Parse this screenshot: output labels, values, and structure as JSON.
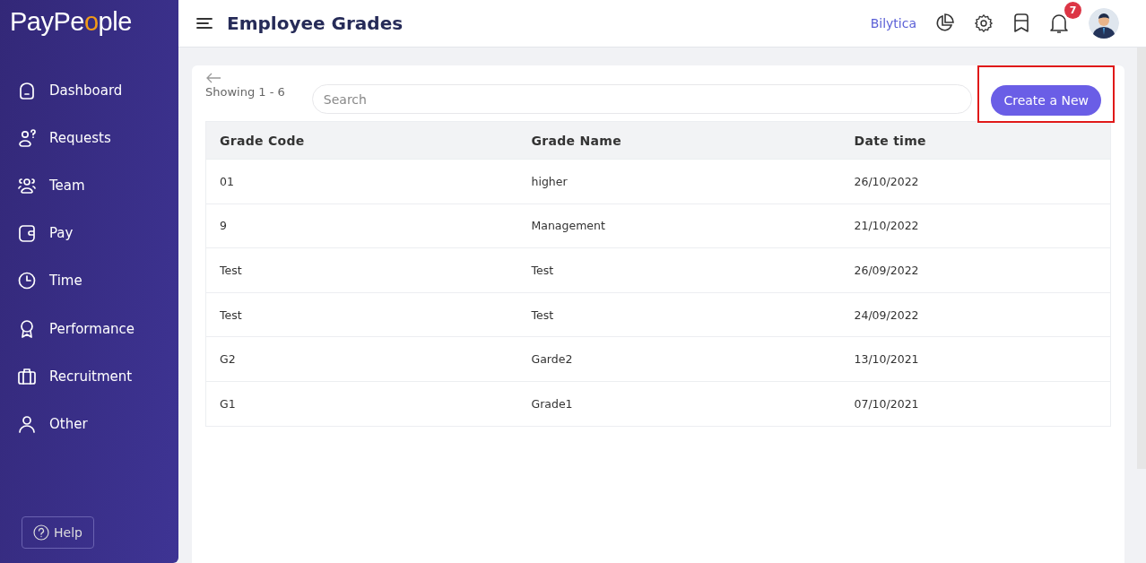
{
  "sidebar": {
    "logo": {
      "before": "PayPe",
      "accent": "o",
      "after": "ple"
    },
    "items": [
      {
        "label": "Dashboard",
        "selected": false
      },
      {
        "label": "Requests",
        "selected": false
      },
      {
        "label": "Team",
        "selected": false
      },
      {
        "label": "Pay",
        "selected": false
      },
      {
        "label": "Time",
        "selected": false
      },
      {
        "label": "Performance",
        "selected": false
      },
      {
        "label": "Recruitment",
        "selected": false
      },
      {
        "label": "Other",
        "selected": false
      }
    ],
    "help": {
      "label": "Help"
    }
  },
  "header": {
    "title": "Employee Grades",
    "link": "Bilytica",
    "notification_count": "7"
  },
  "content": {
    "showing": "Showing 1 - 6",
    "search": {
      "placeholder": "Search"
    },
    "create_button": {
      "label": "Create a New",
      "highlighted": true
    },
    "table": {
      "columns": [
        "Grade Code",
        "Grade Name",
        "Date time"
      ],
      "rows": [
        [
          "01",
          "higher",
          "26/10/2022"
        ],
        [
          "9",
          "Management",
          "21/10/2022"
        ],
        [
          "Test",
          "Test",
          "26/09/2022"
        ],
        [
          "Test",
          "Test",
          "24/09/2022"
        ],
        [
          "G2",
          "Garde2",
          "13/10/2021"
        ],
        [
          "G1",
          "Grade1",
          "07/10/2021"
        ]
      ]
    }
  }
}
